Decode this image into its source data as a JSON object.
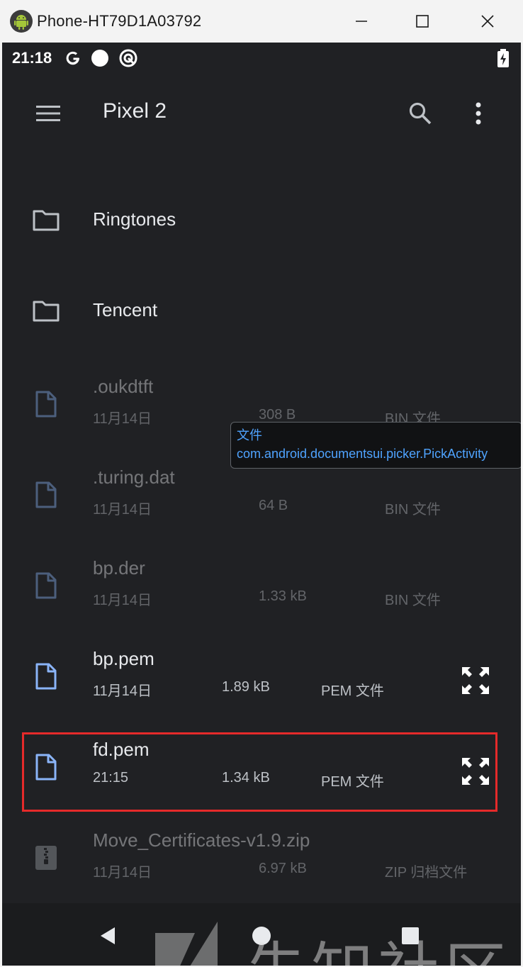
{
  "window": {
    "title": "Phone-HT79D1A03792"
  },
  "status_bar": {
    "time": "21:18",
    "icons": [
      "google-g-icon",
      "circle-notification-icon",
      "sync-icon",
      "battery-charging-icon"
    ]
  },
  "app_bar": {
    "title": "Pixel 2",
    "icons": [
      "menu-icon",
      "search-icon",
      "more-vert-icon"
    ]
  },
  "folders": [
    {
      "name": "Ringtones"
    },
    {
      "name": "Tencent"
    }
  ],
  "files": [
    {
      "name": ".oukdtft",
      "date": "11月14日",
      "size": "308 B",
      "type": "BIN 文件",
      "enabled": false
    },
    {
      "name": ".turing.dat",
      "date": "11月14日",
      "size": "64 B",
      "type": "BIN 文件",
      "enabled": false
    },
    {
      "name": "bp.der",
      "date": "11月14日",
      "size": "1.33 kB",
      "type": "BIN 文件",
      "enabled": false
    },
    {
      "name": "bp.pem",
      "date": "11月14日",
      "size": "1.89 kB",
      "type": "PEM 文件",
      "enabled": true
    },
    {
      "name": "fd.pem",
      "date": "21:15",
      "size": "1.34 kB",
      "type": "PEM 文件",
      "enabled": true,
      "highlighted": true
    },
    {
      "name": "Move_Certificates-v1.9.zip",
      "date": "11月14日",
      "size": "6.97 kB",
      "type": "ZIP 归档文件",
      "enabled": false
    }
  ],
  "tooltip": {
    "line1": "文件",
    "line2": "com.android.documentsui.picker.PickActivity"
  },
  "nav_bar": {
    "icons": [
      "back-icon",
      "home-icon",
      "recents-icon"
    ]
  },
  "watermark": {
    "text": "先知社区"
  },
  "colors": {
    "screen_bg": "#202124",
    "accent_file": "#8ab4f8",
    "tooltip_text": "#4fa3ff",
    "highlight_border": "#e52a2a"
  }
}
